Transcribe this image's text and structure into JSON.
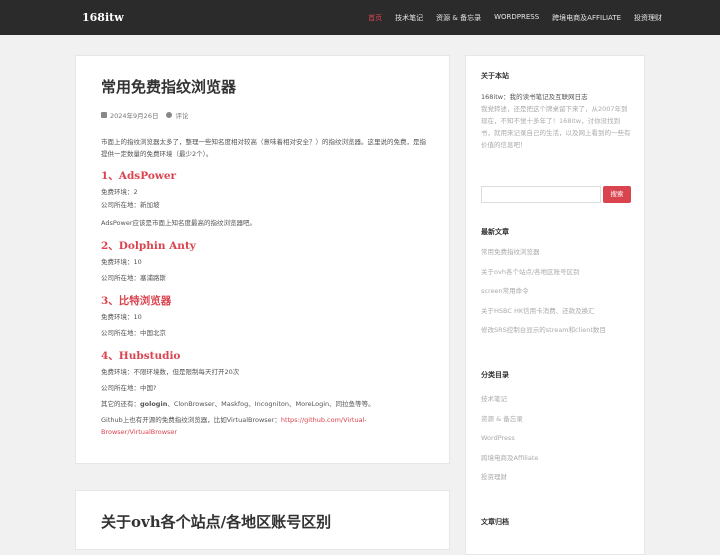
{
  "header": {
    "brand": "168itw",
    "nav": [
      "首页",
      "技术笔记",
      "资源 & 备忘录",
      "WORDPRESS",
      "跨境电商及AFFILIATE",
      "投资理财"
    ]
  },
  "post1": {
    "title": "常用免费指纹浏览器",
    "date": "2024年9月26日",
    "comment": "评论",
    "intro": "市面上的指纹浏览器太多了，整理一些知名度相对较高（意味着相对安全？）的指纹浏览器。这里说的免费，是指提供一定数量的免费环境（最少2个）。",
    "sections": [
      {
        "heading": "1、AdsPower",
        "env": "免费环境：2",
        "loc": "公司所在地：新加坡",
        "note": "AdsPower应该是市面上知名度最高的指纹浏览器吧。"
      },
      {
        "heading": "2、Dolphin Anty",
        "env": "免费环境：10",
        "loc": "公司所在地：塞浦路斯"
      },
      {
        "heading": "3、比特浏览器",
        "env": "免费环境：10",
        "loc": "公司所在地：中国北京"
      },
      {
        "heading": "4、Hubstudio",
        "env": "免费环境：不限环境数，但是限制每天打开20次",
        "loc": "公司所在地：中国?"
      }
    ],
    "others_prefix": "其它的还有：",
    "others_bold": "gologin",
    "others_rest": "、ClonBrowser、Maskfog、Incogniton、MoreLogin、同拉鱼等等。",
    "github_text": "Github上也有开源的免费指纹浏览器，比如VirtualBrowser：",
    "github_link": "https://github.com/Virtual-Browser/VirtualBrowser"
  },
  "post2": {
    "title": "关于ovh各个站点/各地区账号区别"
  },
  "sidebar": {
    "about_title": "关于本站",
    "about_strong": "168itw：我的读书笔记及互联网日志",
    "about_text": "我党转述，还是把这个牌桌留下来了，从2007年到现在，不知不觉十多年了！168itw，讨你没找到书，就用来记录自己的生活，以及网上看到的一些有价值的信息吧！",
    "search_button": "搜索",
    "recent_title": "最新文章",
    "recent": [
      "常用免费指纹浏览器",
      "关于ovh各个站点/各地区账号区别",
      "screen常用命令",
      "关于HSBC HK信用卡消费、还款及换汇",
      "修改SRS控制台显示的stream和client数目"
    ],
    "cat_title": "分类目录",
    "categories": [
      "技术笔记",
      "资源 & 备忘录",
      "WordPress",
      "跨境电商及Affiliate",
      "投资理财"
    ],
    "archive_title": "文章归档"
  },
  "colors": {
    "accent": "#d9444f",
    "topbar": "#2b2b2b",
    "background": "#f1f1f1"
  }
}
